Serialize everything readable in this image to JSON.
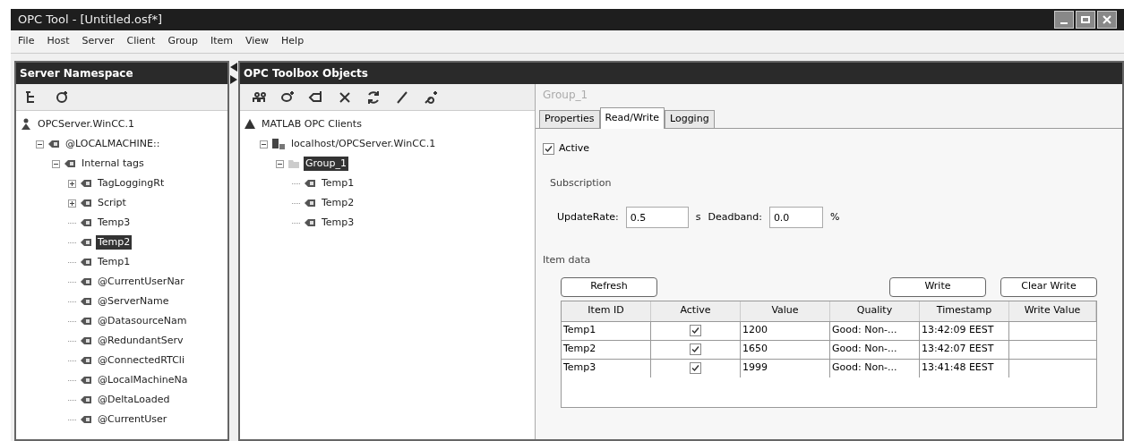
{
  "window": {
    "title": "OPC Tool - [Untitled.osf*]"
  },
  "menu": [
    "File",
    "Host",
    "Server",
    "Client",
    "Group",
    "Item",
    "View",
    "Help"
  ],
  "server_namespace": {
    "title": "Server Namespace",
    "tree": [
      {
        "label": "OPCServer.WinCC.1",
        "kind": "server",
        "selected": false,
        "children": [
          {
            "label": "@LOCALMACHINE::",
            "kind": "tag",
            "selected": false,
            "expanded": true,
            "children": [
              {
                "label": "Internal tags",
                "kind": "tag",
                "selected": false,
                "expanded": true,
                "children": [
                  {
                    "label": "TagLoggingRt",
                    "kind": "tag",
                    "selected": false,
                    "expanded": false
                  },
                  {
                    "label": "Script",
                    "kind": "tag",
                    "selected": false,
                    "expanded": false
                  },
                  {
                    "label": "Temp3",
                    "kind": "tag",
                    "selected": false
                  },
                  {
                    "label": "Temp2",
                    "kind": "tag",
                    "selected": true
                  },
                  {
                    "label": "Temp1",
                    "kind": "tag",
                    "selected": false
                  },
                  {
                    "label": "@CurrentUserNar",
                    "kind": "tag",
                    "selected": false
                  },
                  {
                    "label": "@ServerName",
                    "kind": "tag",
                    "selected": false
                  },
                  {
                    "label": "@DatasourceNam",
                    "kind": "tag",
                    "selected": false
                  },
                  {
                    "label": "@RedundantServ",
                    "kind": "tag",
                    "selected": false
                  },
                  {
                    "label": "@ConnectedRTCli",
                    "kind": "tag",
                    "selected": false
                  },
                  {
                    "label": "@LocalMachineNa",
                    "kind": "tag",
                    "selected": false
                  },
                  {
                    "label": "@DeltaLoaded",
                    "kind": "tag",
                    "selected": false
                  },
                  {
                    "label": "@CurrentUser",
                    "kind": "tag",
                    "selected": false
                  }
                ]
              }
            ]
          }
        ]
      }
    ]
  },
  "toolbox": {
    "title": "OPC Toolbox Objects",
    "tree": [
      {
        "label": "MATLAB OPC Clients",
        "kind": "root",
        "selected": false,
        "children": [
          {
            "label": "localhost/OPCServer.WinCC.1",
            "kind": "host",
            "selected": false,
            "expanded": true,
            "children": [
              {
                "label": "Group_1",
                "kind": "group",
                "selected": true,
                "expanded": true,
                "children": [
                  {
                    "label": "Temp1",
                    "kind": "tag",
                    "selected": false
                  },
                  {
                    "label": "Temp2",
                    "kind": "tag",
                    "selected": false
                  },
                  {
                    "label": "Temp3",
                    "kind": "tag",
                    "selected": false
                  }
                ]
              }
            ]
          }
        ]
      }
    ]
  },
  "details": {
    "title": "Group_1",
    "tabs": [
      {
        "label": "Properties",
        "selected": false
      },
      {
        "label": "Read/Write",
        "selected": true
      },
      {
        "label": "Logging",
        "selected": false
      }
    ],
    "active": {
      "label": "Active",
      "checked": true
    },
    "subscription": {
      "title": "Subscription",
      "update_rate": {
        "label": "UpdateRate:",
        "value": "0.5",
        "unit": "s"
      },
      "deadband": {
        "label": "Deadband:",
        "value": "0.0",
        "unit": "%"
      }
    },
    "item_data": {
      "title": "Item data",
      "refresh": "Refresh",
      "write": "Write",
      "clear_write": "Clear Write",
      "columns": [
        "Item ID",
        "Active",
        "Value",
        "Quality",
        "Timestamp",
        "Write Value"
      ],
      "rows": [
        {
          "item_id": "Temp1",
          "active": true,
          "value": "1200",
          "quality": "Good: Non-...",
          "timestamp": "13:42:09 EEST"
        },
        {
          "item_id": "Temp2",
          "active": true,
          "value": "1650",
          "quality": "Good: Non-...",
          "timestamp": "13:42:07 EEST"
        },
        {
          "item_id": "Temp3",
          "active": true,
          "value": "1999",
          "quality": "Good: Non-...",
          "timestamp": "13:41:48 EEST"
        }
      ]
    }
  }
}
